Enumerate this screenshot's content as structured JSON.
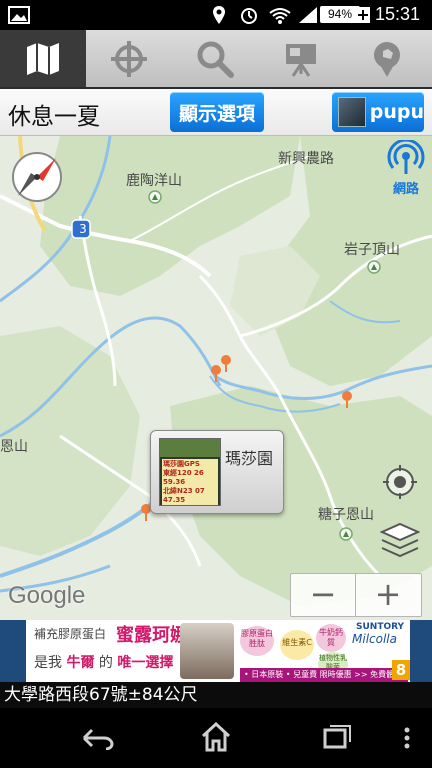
{
  "status_bar": {
    "battery": "94%",
    "time": "15:31"
  },
  "tabs": [
    {
      "name": "map",
      "icon": "map-icon",
      "active": true
    },
    {
      "name": "locate",
      "icon": "crosshair-icon",
      "active": false
    },
    {
      "name": "search",
      "icon": "search-icon",
      "active": false
    },
    {
      "name": "board",
      "icon": "easel-icon",
      "active": false
    },
    {
      "name": "checkin",
      "icon": "pin-icon",
      "active": false
    }
  ],
  "header": {
    "title": "休息一夏",
    "options_button": "顯示選項",
    "user_button": "pupu"
  },
  "map": {
    "labels": {
      "road_north": "新興農路",
      "mountain_1": "鹿陶洋山",
      "mountain_2": "岩子頂山",
      "mountain_3": "糖子恩山",
      "mountain_left": "恩山",
      "route_number": "3",
      "network_label": "網路",
      "google": "Google"
    },
    "popup": {
      "title": "瑪莎園",
      "thumb_lines": [
        "瑪莎園GPS",
        "東經120 26 59.36",
        "北緯N23 07 47.35"
      ]
    },
    "zoom_out": "−",
    "zoom_in": "+"
  },
  "ad": {
    "line1": "補充膠原蛋白",
    "brand_cn": "蜜露珂娜",
    "line2_a": "是我",
    "line2_b": "牛爾",
    "line2_c": "的",
    "line2_d": "唯一選擇",
    "brand_en": "SUNTORY",
    "product": "Milcolla",
    "bottom": "• 日本原裝 • 兒童費 限時優惠 >> 免費體驗",
    "badge1": "膠原蛋白胜肽",
    "badge2": "維生素C",
    "badge3": "牛奶鈣質",
    "badge4": "植物性乳酸菌",
    "count": "8"
  },
  "address": "大學路西段67號±84公尺",
  "colors": {
    "blue_button": "#1a8df0",
    "map_bg": "#e7ece0",
    "forest": "#cfe0bf",
    "river": "#8ec2e8",
    "pin": "#f07d3c"
  }
}
